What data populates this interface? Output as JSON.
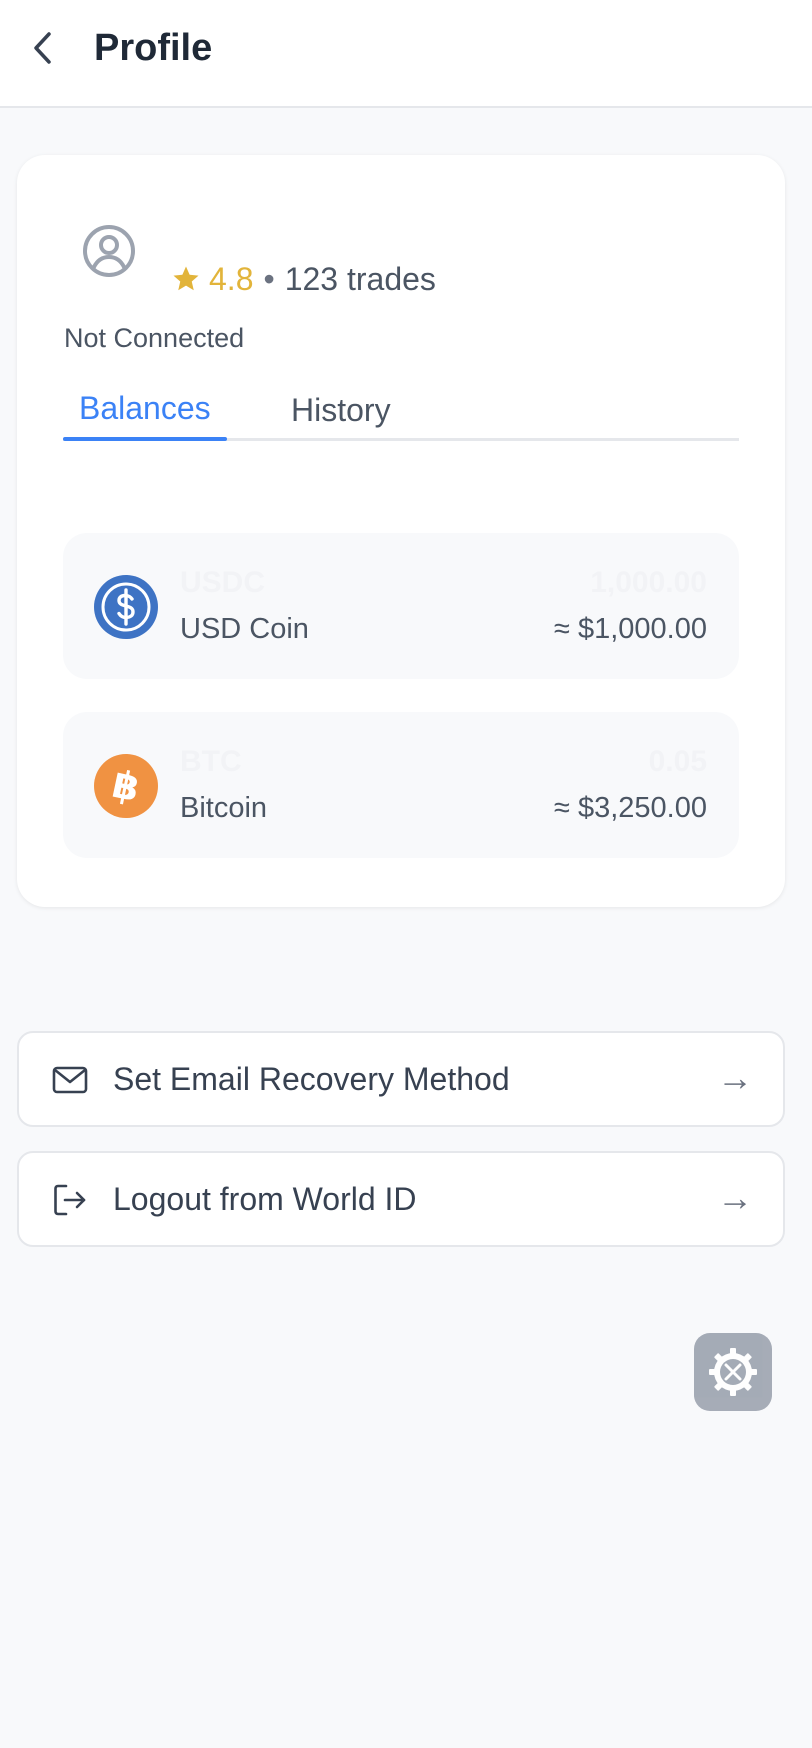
{
  "header": {
    "title": "Profile",
    "back_icon": "chevron-left-icon"
  },
  "profile": {
    "avatar_icon": "user-circle-icon",
    "rating_icon": "star-icon",
    "rating": "4.8",
    "separator": "•",
    "trades": "123 trades",
    "status": "Not Connected"
  },
  "tabs": [
    {
      "label": "Balances",
      "active": true
    },
    {
      "label": "History",
      "active": false
    }
  ],
  "balances": [
    {
      "symbol": "USDC",
      "name": "USD Coin",
      "amount": "1,000.00",
      "value": "≈ $1,000.00",
      "icon": "usdc-icon",
      "color": "#3e73c4"
    },
    {
      "symbol": "BTC",
      "name": "Bitcoin",
      "amount": "0.05",
      "value": "≈ $3,250.00",
      "icon": "bitcoin-icon",
      "color": "#f09242"
    }
  ],
  "actions": {
    "email": {
      "label": "Set Email Recovery Method",
      "arrow": "→",
      "icon": "mail-icon"
    },
    "logout": {
      "label": "Logout from World ID",
      "arrow": "→",
      "icon": "logout-icon"
    }
  },
  "fab": {
    "icon": "tools-gear-icon"
  },
  "colors": {
    "accent": "#3b82f6",
    "rating": "#e2b43a",
    "background": "#f8f9fb"
  }
}
